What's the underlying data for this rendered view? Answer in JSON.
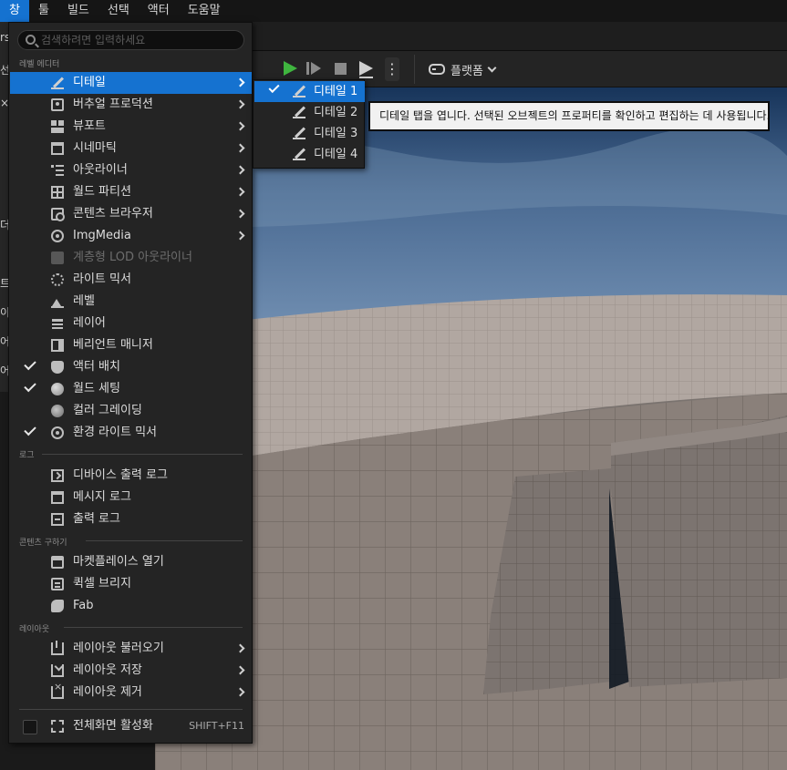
{
  "menubar": {
    "items": [
      "창",
      "툴",
      "빌드",
      "선택",
      "액터",
      "도움말"
    ],
    "active_index": 0
  },
  "background": {
    "left_fragments": [
      "rs",
      "선",
      "×",
      "더",
      "트",
      "이",
      "어",
      "어"
    ]
  },
  "toolbar": {
    "platform_label": "플랫폼",
    "more_glyph": "⋮"
  },
  "window_menu": {
    "search": {
      "placeholder": "검색하려면 입력하세요",
      "value": ""
    },
    "sections": {
      "level_editor": "레벨 에디터",
      "log": "로그",
      "get_content": "콘텐츠 구하기",
      "layout": "레이아웃"
    },
    "items": [
      {
        "label": "디테일",
        "icon": "pencil-icon",
        "submenu": true,
        "highlighted": true,
        "checked": false
      },
      {
        "label": "버추얼 프로덕션",
        "icon": "camera-icon",
        "submenu": true,
        "checked": false
      },
      {
        "label": "뷰포트",
        "icon": "viewport-icon",
        "submenu": true,
        "checked": false
      },
      {
        "label": "시네마틱",
        "icon": "clapper-icon",
        "submenu": true,
        "checked": false
      },
      {
        "label": "아웃라이너",
        "icon": "list-icon",
        "submenu": true,
        "checked": false
      },
      {
        "label": "월드 파티션",
        "icon": "partition-icon",
        "submenu": true,
        "checked": false
      },
      {
        "label": "콘텐츠 브라우저",
        "icon": "folder-search-icon",
        "submenu": true,
        "checked": false
      },
      {
        "label": "ImgMedia",
        "icon": "film-reel-icon",
        "submenu": true,
        "checked": false
      },
      {
        "label": "계층형 LOD 아웃라이너",
        "icon": "lod-icon",
        "submenu": false,
        "disabled": true,
        "checked": false
      },
      {
        "label": "라이트 믹서",
        "icon": "sun-icon",
        "submenu": false,
        "checked": false
      },
      {
        "label": "레벨",
        "icon": "level-icon",
        "submenu": false,
        "checked": false
      },
      {
        "label": "레이어",
        "icon": "layers-icon",
        "submenu": false,
        "checked": false
      },
      {
        "label": "베리언트 매니저",
        "icon": "variant-icon",
        "submenu": false,
        "checked": false
      },
      {
        "label": "액터 배치",
        "icon": "place-actor-icon",
        "submenu": false,
        "checked": true
      },
      {
        "label": "월드 세팅",
        "icon": "globe-icon",
        "submenu": false,
        "checked": true
      },
      {
        "label": "컬러 그레이딩",
        "icon": "color-wheel-icon",
        "submenu": false,
        "checked": false
      },
      {
        "label": "환경 라이트 믹서",
        "icon": "env-light-icon",
        "submenu": false,
        "checked": true
      }
    ],
    "log_items": [
      {
        "label": "디바이스 출력 로그",
        "icon": "terminal-icon"
      },
      {
        "label": "메시지 로그",
        "icon": "message-log-icon"
      },
      {
        "label": "출력 로그",
        "icon": "output-log-icon"
      }
    ],
    "content_items": [
      {
        "label": "마켓플레이스 열기",
        "icon": "marketplace-icon"
      },
      {
        "label": "퀵셀 브리지",
        "icon": "bridge-icon"
      },
      {
        "label": "Fab",
        "icon": "fab-icon"
      }
    ],
    "layout_items": [
      {
        "label": "레이아웃 불러오기",
        "icon": "layout-load-icon",
        "submenu": true
      },
      {
        "label": "레이아웃 저장",
        "icon": "layout-save-icon",
        "submenu": true
      },
      {
        "label": "레이아웃 제거",
        "icon": "layout-remove-icon",
        "submenu": true
      }
    ],
    "fullscreen": {
      "label": "전체화면 활성화",
      "shortcut": "SHIFT+F11",
      "checked": false
    }
  },
  "details_submenu": {
    "items": [
      {
        "label": "디테일 1",
        "checked": true,
        "highlighted": true
      },
      {
        "label": "디테일 2",
        "checked": false
      },
      {
        "label": "디테일 3",
        "checked": false
      },
      {
        "label": "디테일 4",
        "checked": false
      }
    ]
  },
  "tooltip": {
    "text": "디테일 탭을 엽니다. 선택된 오브젝트의 프로퍼티를 확인하고 편집하는 데 사용됩니다."
  },
  "colors": {
    "accent": "#1572d0",
    "menu_bg": "#242424",
    "play_green": "#3fb53f",
    "sky": "#3f5f86",
    "floor": "#8c827b"
  }
}
